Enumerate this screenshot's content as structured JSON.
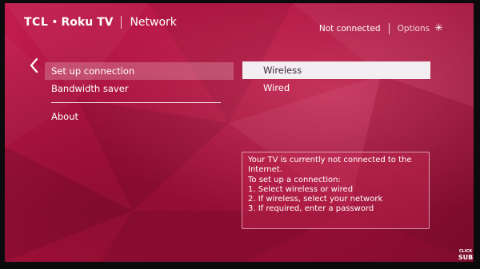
{
  "header": {
    "brand_tcl": "TCL",
    "brand_dot": "•",
    "brand_roku": "Roku TV",
    "section_title": "Network",
    "connection_status": "Not connected",
    "options_label": "Options",
    "options_icon": "asterisk-icon"
  },
  "left_menu": {
    "back_icon": "chevron-left-icon",
    "items": [
      {
        "label": "Set up connection",
        "selected": true
      },
      {
        "label": "Bandwidth saver",
        "selected": false
      },
      {
        "label": "About",
        "selected": false
      }
    ]
  },
  "right_menu": {
    "items": [
      {
        "label": "Wireless",
        "focused": true
      },
      {
        "label": "Wired",
        "focused": false
      }
    ]
  },
  "info_box": {
    "lines": [
      "Your TV is currently not connected to the Internet.",
      "To set up a connection:",
      "1.  Select wireless or wired",
      "2.  If wireless, select your network",
      "3.  If required, enter a password"
    ]
  },
  "watermark": {
    "line1": "CLICK",
    "line2": "SUB"
  },
  "colors": {
    "background_primary": "#b0123f",
    "focus_highlight": "#f3eef2",
    "text": "#ffffff"
  }
}
